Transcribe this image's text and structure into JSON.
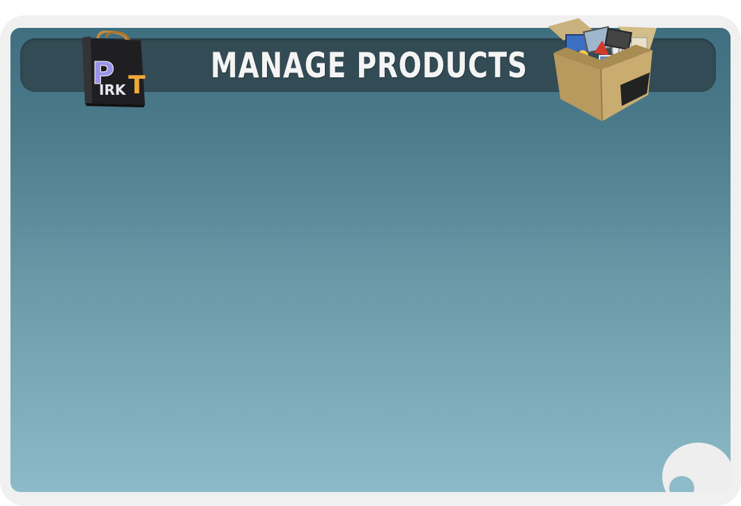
{
  "header": {
    "title": "MANAGE PRODUCTS"
  },
  "logo": {
    "text": "PIRKT",
    "icon": "shopping-bag-icon"
  },
  "header_image": {
    "icon": "box-of-apps-icon"
  },
  "colors": {
    "panel_top": "#3f6f80",
    "panel_bottom": "#8dbac8",
    "header_bar": "#334b55",
    "frame": "#f1f0f1"
  }
}
